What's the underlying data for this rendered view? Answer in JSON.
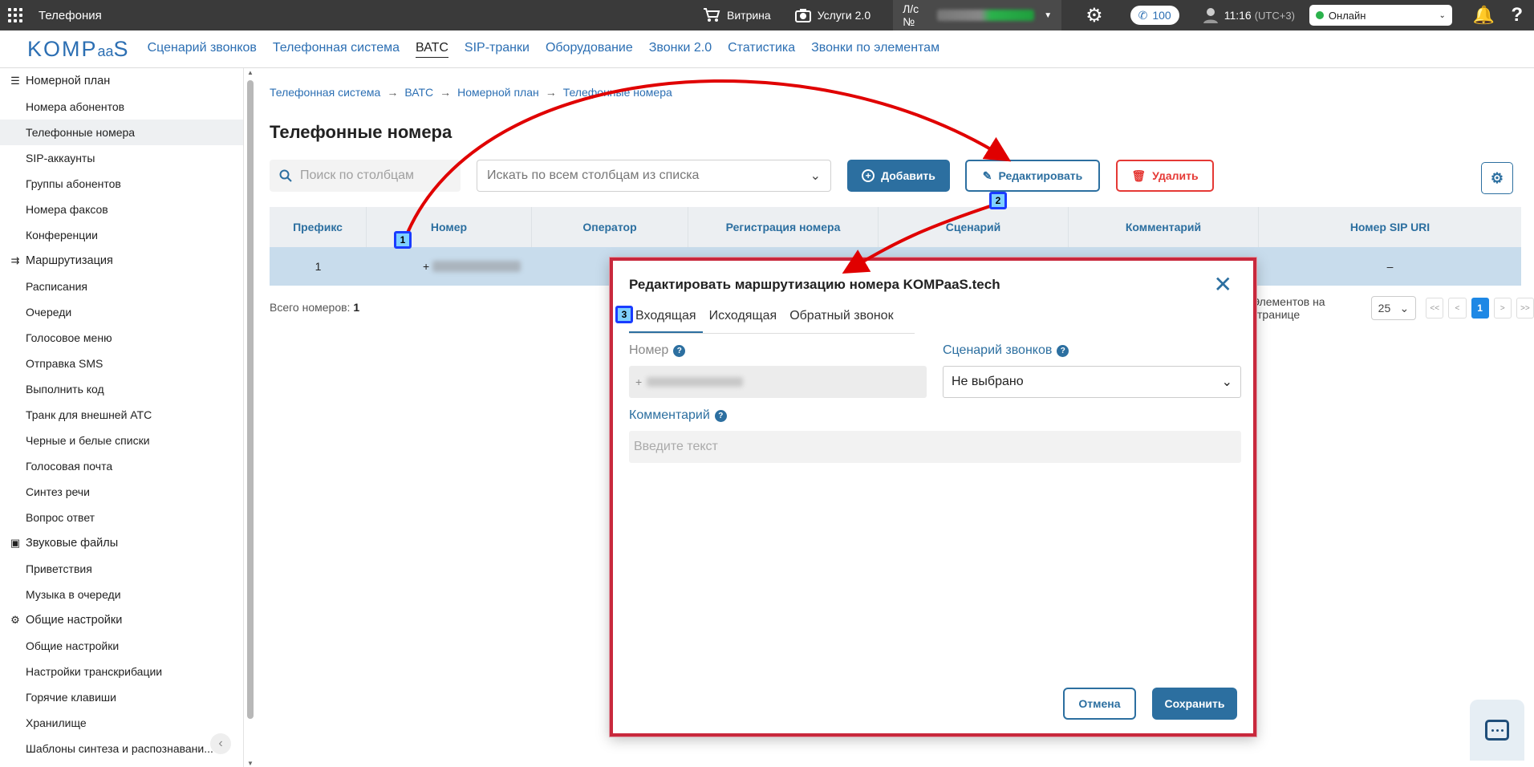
{
  "topbar": {
    "title": "Телефония",
    "showcase": "Витрина",
    "services": "Услуги 2.0",
    "account_label": "Л/с №",
    "calls_count": "100",
    "time": "11:16",
    "timezone": "(UTC+3)",
    "status": "Онлайн",
    "help": "?"
  },
  "logo": {
    "text": "KOMP",
    "small": "aa",
    "tail": "S"
  },
  "nav": [
    {
      "label": "Сценарий звонков"
    },
    {
      "label": "Телефонная система"
    },
    {
      "label": "ВАТС"
    },
    {
      "label": "SIP-транки"
    },
    {
      "label": "Оборудование"
    },
    {
      "label": "Звонки 2.0"
    },
    {
      "label": "Статистика"
    },
    {
      "label": "Звонки по элементам"
    }
  ],
  "sidebar": {
    "numplan": "Номерной план",
    "numplan_items": [
      "Номера абонентов",
      "Телефонные номера",
      "SIP-аккаунты",
      "Группы абонентов",
      "Номера факсов",
      "Конференции"
    ],
    "routing": "Маршрутизация",
    "routing_items": [
      "Расписания",
      "Очереди",
      "Голосовое меню",
      "Отправка SMS",
      "Выполнить код",
      "Транк для внешней АТС",
      "Черные и белые списки",
      "Голосовая почта",
      "Синтез речи",
      "Вопрос ответ"
    ],
    "sounds": "Звуковые файлы",
    "sounds_items": [
      "Приветствия",
      "Музыка в очереди"
    ],
    "general": "Общие настройки",
    "general_items": [
      "Общие настройки",
      "Настройки транскрибации",
      "Горячие клавиши",
      "Хранилище",
      "Шаблоны синтеза и распознавани..."
    ]
  },
  "breadcrumb": [
    "Телефонная система",
    "ВАТС",
    "Номерной план",
    "Телефонные номера"
  ],
  "breadcrumb_sep": "→",
  "page_title": "Телефонные номера",
  "toolbar": {
    "search_placeholder": "Поиск по столбцам",
    "select_all": "Искать по всем столбцам из списка",
    "add": "Добавить",
    "edit": "Редактировать",
    "delete": "Удалить"
  },
  "table": {
    "headers": [
      "Префикс",
      "Номер",
      "Оператор",
      "Регистрация номера",
      "Сценарий",
      "Комментарий",
      "Номер SIP URI"
    ],
    "rows": [
      {
        "prefix": "1",
        "number_prefix": "+",
        "sip_uri": "–"
      }
    ]
  },
  "footer": {
    "total_label": "Всего номеров:",
    "total": "1",
    "per_page_label": "Элементов на странице",
    "per_page": "25",
    "first": "<<",
    "prev": "<",
    "page": "1",
    "next": ">",
    "last": ">>"
  },
  "modal": {
    "title": "Редактировать маршрутизацию номера KOMPaaS.tech",
    "tabs": [
      "Входящая",
      "Исходящая",
      "Обратный звонок"
    ],
    "number_label": "Номер",
    "number_prefix": "+",
    "scenario_label": "Сценарий звонков",
    "scenario_value": "Не выбрано",
    "comment_label": "Комментарий",
    "comment_placeholder": "Введите текст",
    "cancel": "Отмена",
    "save": "Сохранить"
  },
  "markers": [
    "1",
    "2",
    "3"
  ],
  "colors": {
    "accent": "#2c6fa0",
    "danger": "#e53935",
    "arrow": "#e00000",
    "marker_border": "#1a3cff"
  }
}
